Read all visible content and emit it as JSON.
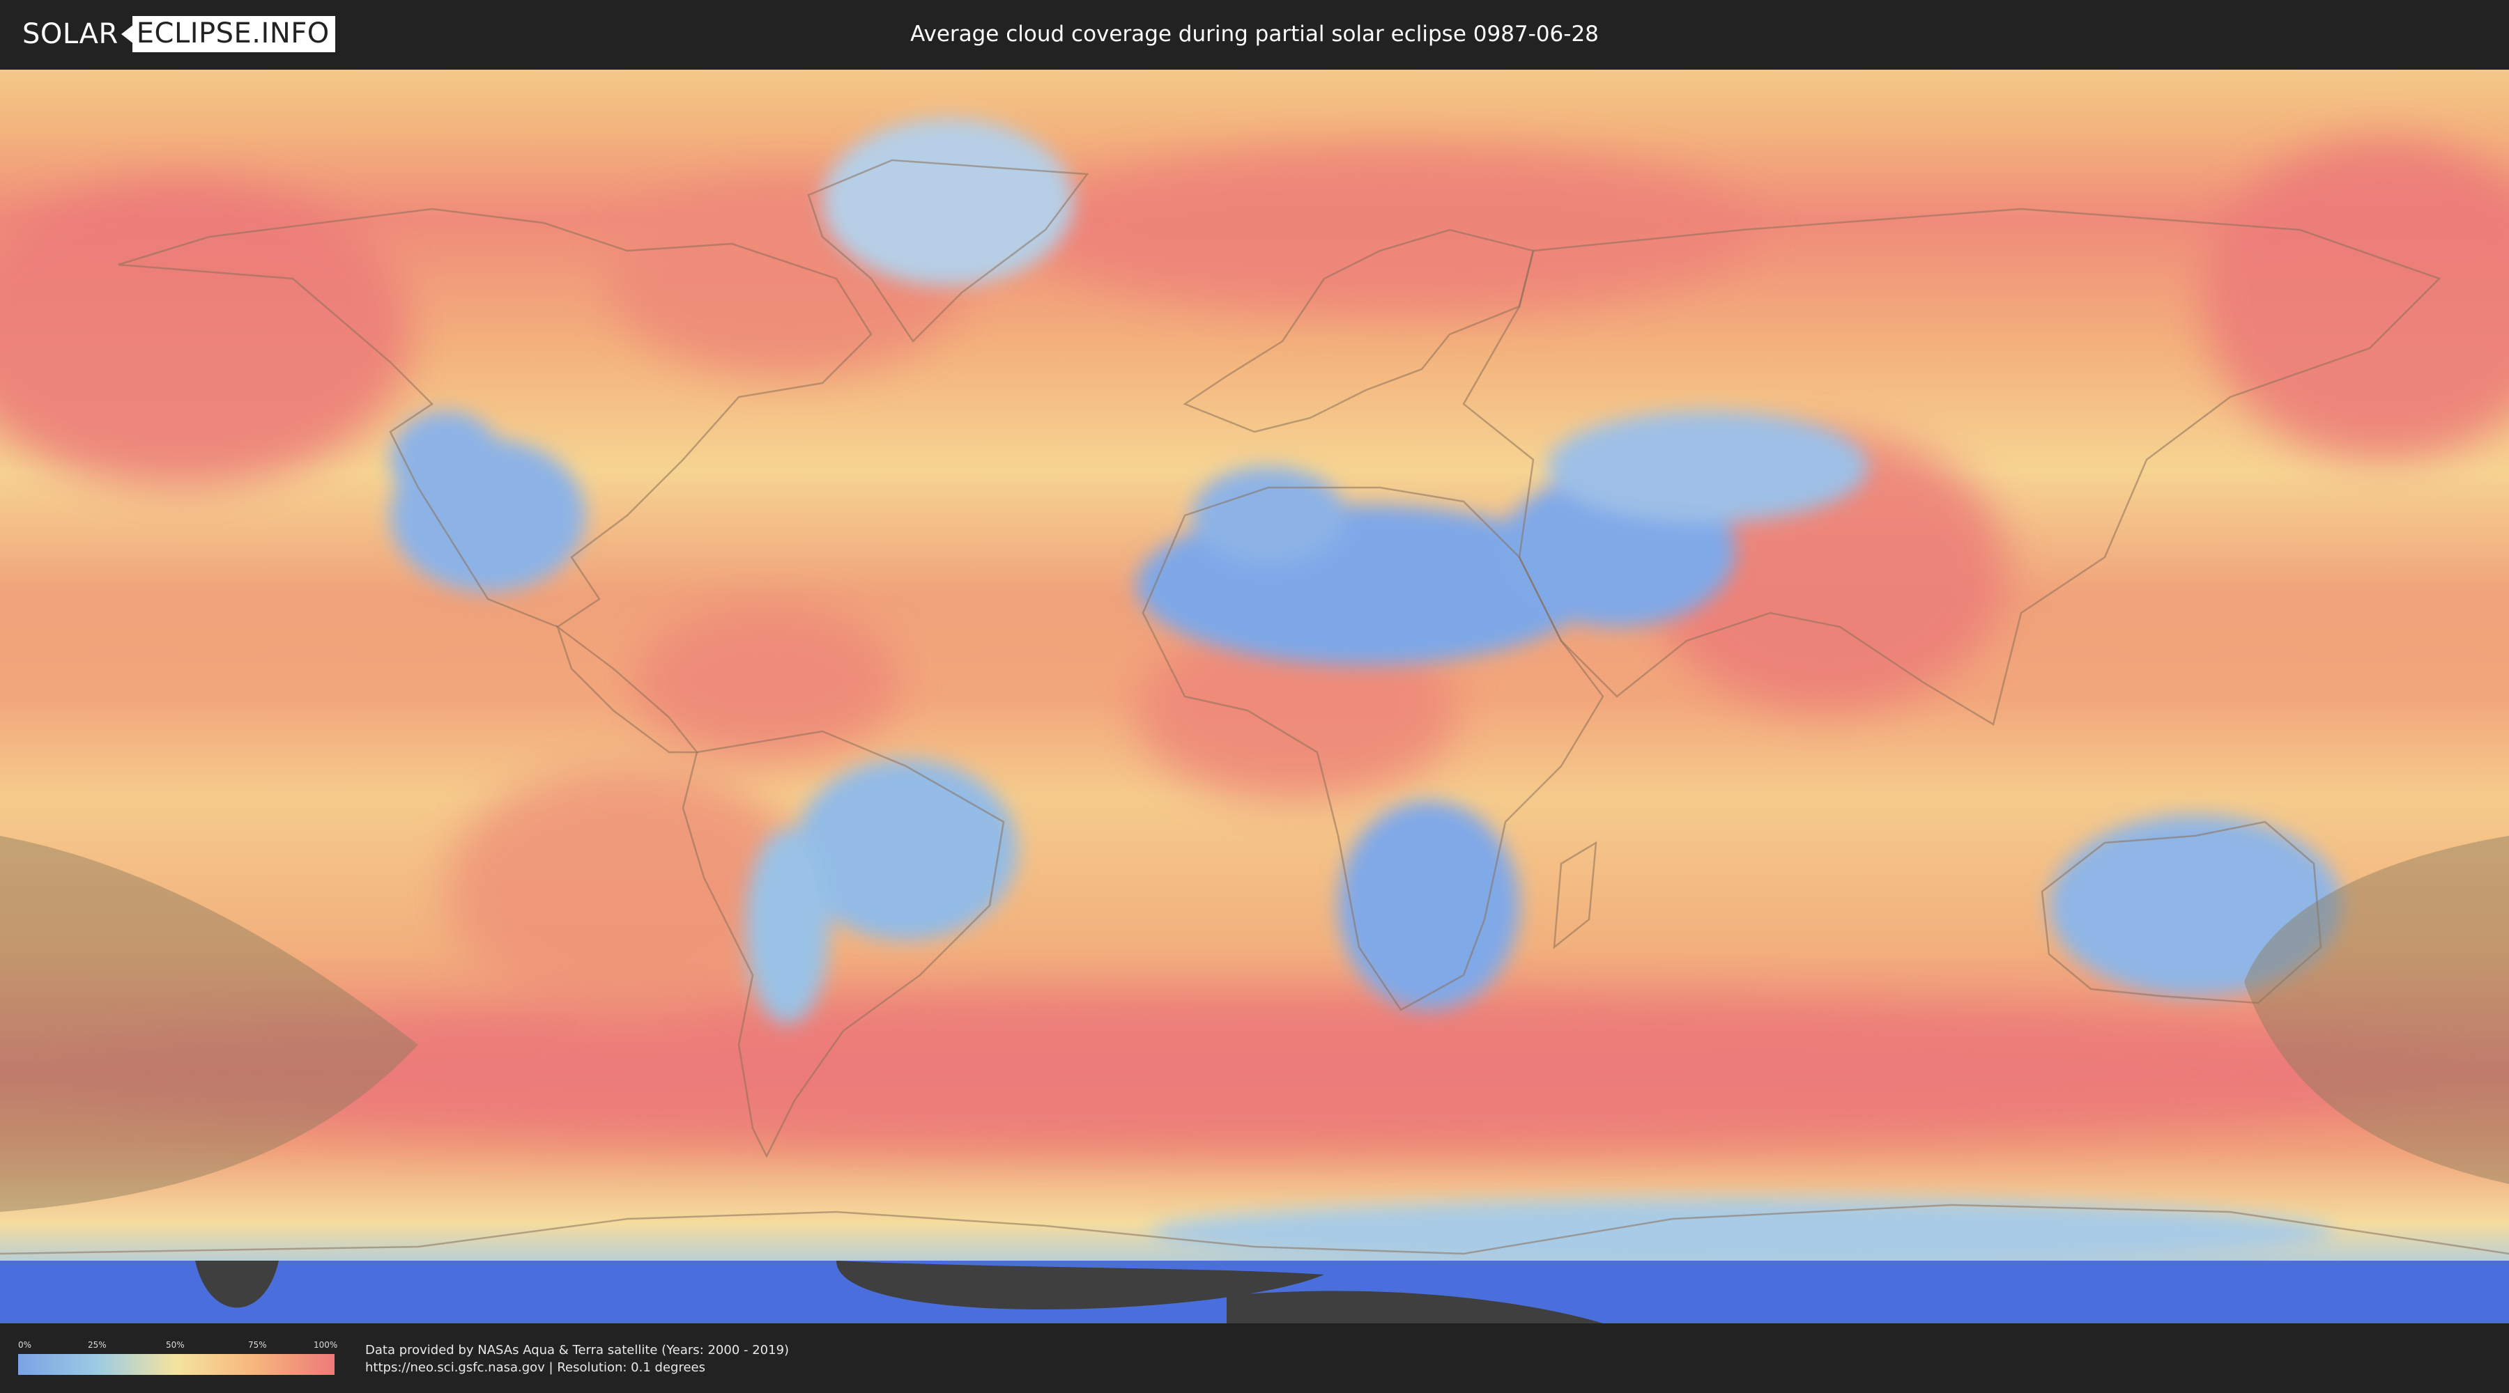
{
  "header": {
    "logo_part1": "SOLAR",
    "logo_part2": "ECLIPSE.INFO",
    "title": "Average cloud coverage during partial solar eclipse 0987-06-28"
  },
  "map": {
    "layer": "average cloud coverage",
    "projection": "equirectangular",
    "palette": {
      "clear": "#7aa3e6",
      "low": "#9ccbe3",
      "mid": "#f5e39f",
      "high": "#f6b57c",
      "overcast": "#ee7a7a",
      "polar_no_data": "#4a6fdc",
      "eclipse_shadow": "#8a7a5a"
    }
  },
  "legend": {
    "ticks": [
      "0%",
      "25%",
      "50%",
      "75%",
      "100%"
    ],
    "colors": [
      "#7aa3e6",
      "#9ccbe3",
      "#f5e39f",
      "#f6b57c",
      "#ee7a7a"
    ]
  },
  "footer": {
    "source_line1": "Data provided by NASAs Aqua & Terra satellite (Years: 2000 - 2019)",
    "source_line2": "https://neo.sci.gsfc.nasa.gov | Resolution: 0.1 degrees"
  }
}
